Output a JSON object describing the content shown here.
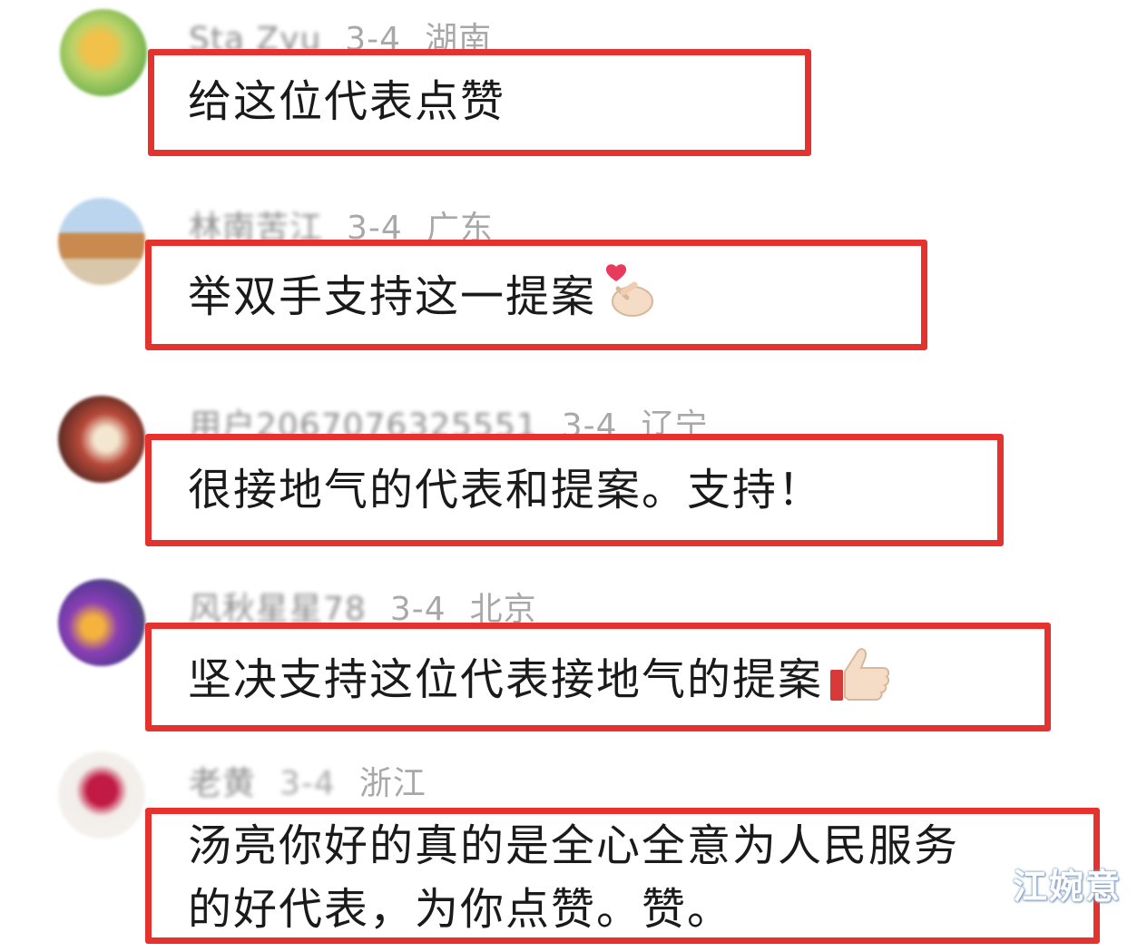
{
  "comments": [
    {
      "username": "Sta Zyu",
      "date": "3-4",
      "location": "湖南",
      "text": "给这位代表点赞",
      "avatar_icon": "avatar-icon"
    },
    {
      "username": "林南苦江",
      "date": "3-4",
      "location": "广东",
      "text": "举双手支持这一提案",
      "emoji": "heart-hand-icon",
      "avatar_icon": "avatar-icon"
    },
    {
      "username": "用户2067076325551",
      "date": "3-4",
      "location": "辽宁",
      "text": "很接地气的代表和提案。支持！",
      "avatar_icon": "avatar-icon"
    },
    {
      "username": "风秋星星78",
      "date": "3-4",
      "location": "北京",
      "text": "坚决支持这位代表接地气的提案",
      "emoji": "thumbs-up-icon",
      "avatar_icon": "avatar-icon"
    },
    {
      "username": "老黄",
      "date": "3-4",
      "location": "浙江",
      "text_line1": "汤亮你好的真的是全心全意为人民服务",
      "text_line2": "的好代表，为你点赞。赞。",
      "avatar_icon": "avatar-icon"
    }
  ],
  "watermark": "江婉意",
  "colors": {
    "highlight_border": "#e4322f",
    "meta_text": "#a8a8a8",
    "body_text": "#1a1a1a"
  }
}
